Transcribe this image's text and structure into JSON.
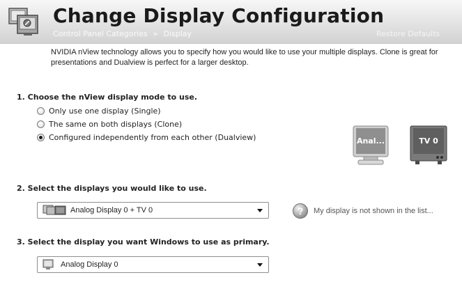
{
  "header": {
    "title": "Change Display Configuration",
    "breadcrumb": [
      "Control Panel Categories",
      "Display"
    ],
    "breadcrumb_separator": "»",
    "restore_defaults": "Restore Defaults",
    "icon": "display-settings-icon"
  },
  "description": "NVIDIA nView technology allows you to specify how you would like to use your multiple displays. Clone is great for presentations and Dualview is perfect for a larger desktop.",
  "step1": {
    "heading": "1. Choose the nView display mode to use.",
    "options": [
      {
        "label": "Only use one display (Single)",
        "checked": false
      },
      {
        "label": "The same on both displays (Clone)",
        "checked": false
      },
      {
        "label": "Configured independently from each other (Dualview)",
        "checked": true
      }
    ],
    "preview": {
      "analog_label": "Anal...",
      "tv_label": "TV 0"
    }
  },
  "step2": {
    "heading": "2. Select the displays you would like to use.",
    "selected": "Analog Display 0 + TV 0",
    "help_text": "My display is not shown in the list..."
  },
  "step3": {
    "heading": "3. Select the display you want Windows to use as primary.",
    "selected": "Analog Display 0"
  },
  "colors": {
    "banner_light": "#f7f7f7",
    "banner_dark": "#d2d2d2",
    "tile_gray": "#9a9a9a",
    "tile_dark": "#5f5f5f"
  }
}
